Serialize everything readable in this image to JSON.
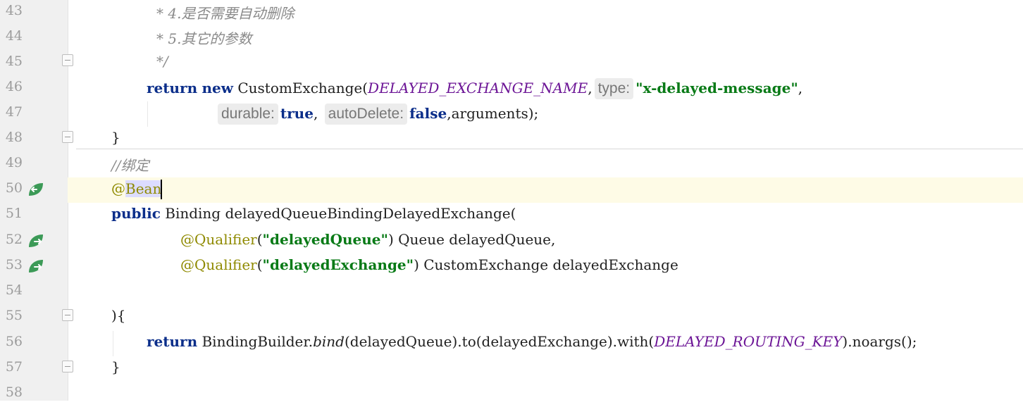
{
  "lines": [
    {
      "num": "43",
      "comment": "* 4.是否需要自动删除"
    },
    {
      "num": "44",
      "comment": "* 5.其它的参数"
    },
    {
      "num": "45",
      "comment": "*/"
    },
    {
      "num": "46",
      "kw_return": "return",
      "kw_new": "new",
      "cls": "CustomExchange(",
      "const": "DELAYED_EXCHANGE_NAME",
      "comma": ",",
      "hint": "type:",
      "str": "\"x-delayed-message\"",
      "end": ","
    },
    {
      "num": "47",
      "hint_durable": "durable:",
      "val_true": "true",
      "comma": ",",
      "hint_auto": "autoDelete:",
      "val_false": "false",
      "rest": ",arguments);"
    },
    {
      "num": "48",
      "text": "}"
    },
    {
      "num": "49",
      "comment": "//绑定"
    },
    {
      "num": "50",
      "ann_at": "@",
      "ann_name": "Bean"
    },
    {
      "num": "51",
      "kw_public": "public",
      "rest": " Binding delayedQueueBindingDelayedExchange("
    },
    {
      "num": "52",
      "ann": "@Qualifier",
      "open": "(",
      "str": "\"delayedQueue\"",
      "rest": ") Queue delayedQueue,"
    },
    {
      "num": "53",
      "ann": "@Qualifier",
      "open": "(",
      "str": "\"delayedExchange\"",
      "rest": ") CustomExchange delayedExchange"
    },
    {
      "num": "54"
    },
    {
      "num": "55",
      "text": "){"
    },
    {
      "num": "56",
      "kw_return": "return",
      "p1": " BindingBuilder.",
      "static": "bind",
      "p2": "(delayedQueue).to(delayedExchange).with(",
      "const": "DELAYED_ROUTING_KEY",
      "p3": ").noargs();"
    },
    {
      "num": "57",
      "text": "}"
    },
    {
      "num": "58"
    }
  ],
  "colors": {
    "keyword": "#0b2e8a",
    "string": "#087a16",
    "constant": "#6c1596",
    "annotation": "#8f8a00",
    "comment": "#8a8a8a",
    "bean_icon": "#3c9a57"
  }
}
